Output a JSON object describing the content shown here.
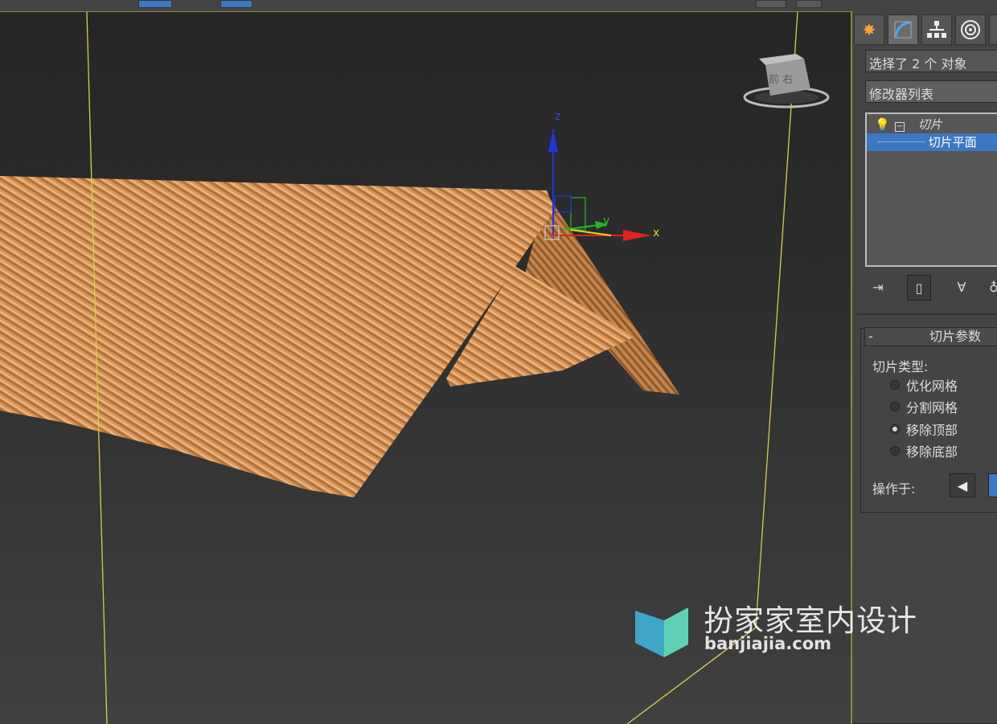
{
  "viewport": {
    "gizmo_labels": {
      "x": "x",
      "y": "y",
      "z": "z"
    },
    "viewcube_label": "前 右"
  },
  "panel": {
    "tabs": [
      {
        "icon": "create-icon"
      },
      {
        "icon": "modify-icon",
        "active": true
      },
      {
        "icon": "hierarchy-icon"
      },
      {
        "icon": "motion-icon"
      },
      {
        "icon": "display-icon"
      }
    ],
    "selection_text": "选择了 2 个 对象",
    "modifier_list": "修改器列表",
    "stack": {
      "modifier": "切片",
      "sub_item": "切片平面"
    },
    "rollout": {
      "title": "切片参数",
      "collapse": "-",
      "slice_type_label": "切片类型:",
      "options": [
        {
          "label": "优化网格",
          "checked": false
        },
        {
          "label": "分割网格",
          "checked": false
        },
        {
          "label": "移除顶部",
          "checked": true
        },
        {
          "label": "移除底部",
          "checked": false
        }
      ],
      "operate_on_label": "操作于:"
    }
  },
  "watermark": {
    "title": "扮家家室内设计",
    "url": "banjiajia.com"
  },
  "colors": {
    "accent": "#3b78c4",
    "roof": "#d7965a",
    "frame_line": "#d6cf45",
    "axis_x": "#d22",
    "axis_y": "#2b2",
    "axis_z": "#22d"
  }
}
